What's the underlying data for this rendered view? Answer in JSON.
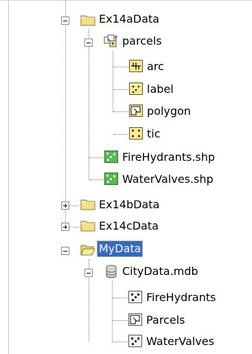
{
  "tree": {
    "nodes": [
      {
        "label": "Ex14aData",
        "icon": "folder-icon",
        "expanded": true
      },
      {
        "label": "parcels",
        "icon": "coverage-icon",
        "expanded": true
      },
      {
        "label": "arc",
        "icon": "arc-feature-class-icon"
      },
      {
        "label": "label",
        "icon": "label-point-feature-class-icon"
      },
      {
        "label": "polygon",
        "icon": "polygon-feature-class-icon"
      },
      {
        "label": "tic",
        "icon": "tic-feature-class-icon"
      },
      {
        "label": "FireHydrants.shp",
        "icon": "shapefile-point-icon"
      },
      {
        "label": "WaterValves.shp",
        "icon": "shapefile-point-icon"
      },
      {
        "label": "Ex14bData",
        "icon": "folder-icon",
        "expanded": false
      },
      {
        "label": "Ex14cData",
        "icon": "folder-icon",
        "expanded": false
      },
      {
        "label": "MyData",
        "icon": "open-folder-icon",
        "expanded": true,
        "selected": true
      },
      {
        "label": "CityData.mdb",
        "icon": "geodatabase-icon",
        "expanded": true
      },
      {
        "label": "FireHydrants",
        "icon": "point-feature-class-icon"
      },
      {
        "label": "Parcels",
        "icon": "polygon-feature-class-icon"
      },
      {
        "label": "WaterValves",
        "icon": "point-feature-class-icon"
      }
    ]
  },
  "colors": {
    "selection": "#316ac5",
    "folder": "#f2e08a",
    "shapefile": "#4fbf4f",
    "featureclass": "#f7e98f"
  }
}
